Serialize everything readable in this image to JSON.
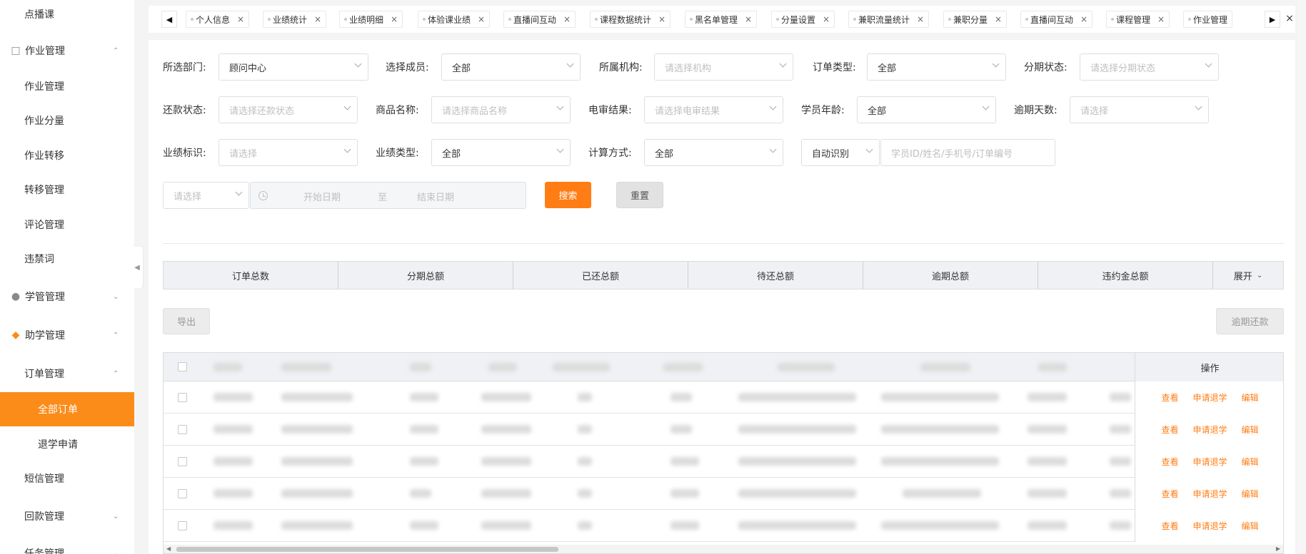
{
  "sidebar": {
    "items": [
      {
        "label": "点播课",
        "kind": "sub"
      },
      {
        "label": "作业管理",
        "kind": "group",
        "icon": "book-icon",
        "caret": "up"
      },
      {
        "label": "作业管理",
        "kind": "sub"
      },
      {
        "label": "作业分量",
        "kind": "sub"
      },
      {
        "label": "作业转移",
        "kind": "sub"
      },
      {
        "label": "转移管理",
        "kind": "sub"
      },
      {
        "label": "评论管理",
        "kind": "sub"
      },
      {
        "label": "违禁词",
        "kind": "sub"
      },
      {
        "label": "学管管理",
        "kind": "group",
        "icon": "user-icon",
        "caret": "down"
      },
      {
        "label": "助学管理",
        "kind": "group",
        "icon": "layers-icon",
        "caret": "up"
      },
      {
        "label": "订单管理",
        "kind": "sub",
        "caret": "up"
      },
      {
        "label": "全部订单",
        "kind": "subsub",
        "active": true
      },
      {
        "label": "退学申请",
        "kind": "subsub"
      },
      {
        "label": "短信管理",
        "kind": "sub"
      },
      {
        "label": "回款管理",
        "kind": "sub",
        "caret": "down"
      },
      {
        "label": "任务管理",
        "kind": "sub",
        "caret": "down"
      }
    ]
  },
  "tags": [
    "个人信息",
    "业绩统计",
    "业绩明细",
    "体验课业绩",
    "直播间互动",
    "课程数据统计",
    "黑名单管理",
    "分量设置",
    "兼职流量统计",
    "兼职分量",
    "直播间互动",
    "课程管理",
    "作业管理"
  ],
  "filters": {
    "department": {
      "label": "所选部门:",
      "value": "顾问中心"
    },
    "member": {
      "label": "选择成员:",
      "value": "全部"
    },
    "org": {
      "label": "所属机构:",
      "placeholder": "请选择机构"
    },
    "order_type": {
      "label": "订单类型:",
      "value": "全部"
    },
    "installment_status": {
      "label": "分期状态:",
      "placeholder": "请选择分期状态"
    },
    "repay_status": {
      "label": "还款状态:",
      "placeholder": "请选择还款状态"
    },
    "product_name": {
      "label": "商品名称:",
      "placeholder": "请选择商品名称"
    },
    "review_result": {
      "label": "电审结果:",
      "placeholder": "请选择电审结果"
    },
    "student_age": {
      "label": "学员年龄:",
      "value": "全部"
    },
    "overdue_days": {
      "label": "逾期天数:",
      "placeholder": "请选择"
    },
    "perf_mark": {
      "label": "业绩标识:",
      "placeholder": "请选择"
    },
    "perf_type": {
      "label": "业绩类型:",
      "value": "全部"
    },
    "calc_method": {
      "label": "计算方式:",
      "value": "全部"
    },
    "auto_detect": {
      "value": "自动识别"
    },
    "keyword": {
      "placeholder": "学员ID/姓名/手机号/订单编号"
    },
    "date_select": {
      "placeholder": "请选择"
    },
    "date_start": "开始日期",
    "date_to": "至",
    "date_end": "结束日期",
    "search_button": "搜索",
    "reset_button": "重置"
  },
  "summary": {
    "columns": [
      "订单总数",
      "分期总额",
      "已还总额",
      "待还总额",
      "逾期总额",
      "违约金总额"
    ],
    "expand": "展开"
  },
  "actions": {
    "export": "导出",
    "overdue_repay": "逾期还款"
  },
  "table": {
    "ops_header": "操作",
    "row_actions": [
      "查看",
      "申请退学",
      "编辑"
    ],
    "row_count": 5
  },
  "colors": {
    "accent": "#ff7d14",
    "sidebar_active": "#fb8c1a"
  }
}
